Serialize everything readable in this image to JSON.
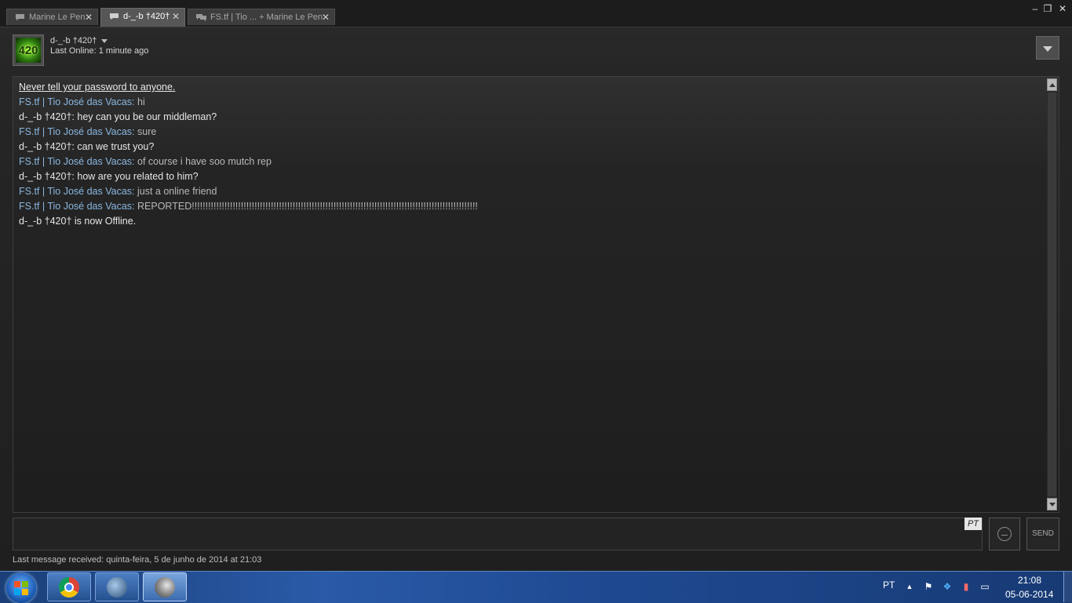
{
  "tabs": [
    {
      "label": "Marine Le Pen",
      "active": false
    },
    {
      "label": "d-_-b  †420†",
      "active": true
    },
    {
      "label": "FS.tf | Tio ... + Marine Le Pen",
      "active": false
    }
  ],
  "window_controls": {
    "minimize": "–",
    "restore": "❐",
    "close": "✕"
  },
  "header": {
    "avatar_text": "420",
    "friend_name": "d-_-b  †420†",
    "status": "Last Online: 1 minute ago"
  },
  "chat": {
    "warning": "Never tell your password to anyone.",
    "messages": [
      {
        "sender": "FS.tf | Tio José das Vacas:",
        "text": " hi",
        "from": "other"
      },
      {
        "sender": "d-_-b  †420†:",
        "text": " hey can you be our middleman?",
        "from": "friend"
      },
      {
        "sender": "FS.tf | Tio José das Vacas:",
        "text": " sure",
        "from": "other"
      },
      {
        "sender": "d-_-b  †420†:",
        "text": " can we trust you?",
        "from": "friend"
      },
      {
        "sender": "FS.tf | Tio José das Vacas:",
        "text": " of course i have soo mutch rep",
        "from": "other"
      },
      {
        "sender": "d-_-b  †420†:",
        "text": " how are you related to him?",
        "from": "friend"
      },
      {
        "sender": "FS.tf | Tio José das Vacas:",
        "text": " just a online friend",
        "from": "other"
      },
      {
        "sender": "FS.tf | Tio José das Vacas:",
        "text": " REPORTED!!!!!!!!!!!!!!!!!!!!!!!!!!!!!!!!!!!!!!!!!!!!!!!!!!!!!!!!!!!!!!!!!!!!!!!!!!!!!!!!!!!!!!!!!!!!!!!!!!!!!!!!!",
        "from": "other"
      }
    ],
    "offline_notice": "d-_-b  †420† is now Offline."
  },
  "input": {
    "value": "",
    "language_badge": "PT",
    "send_label": "SEND"
  },
  "footer": {
    "last_received": "Last message received: quinta-feira, 5 de junho de 2014 at 21:03"
  },
  "taskbar": {
    "apps": [
      "chrome-icon",
      "tf-icon",
      "steam-icon"
    ],
    "language": "PT",
    "time": "21:08",
    "date": "05-06-2014"
  },
  "colors": {
    "other_sender": "#8ab7e0",
    "friend_sender": "#e6e6e6",
    "taskbar": "#1f4a92"
  }
}
